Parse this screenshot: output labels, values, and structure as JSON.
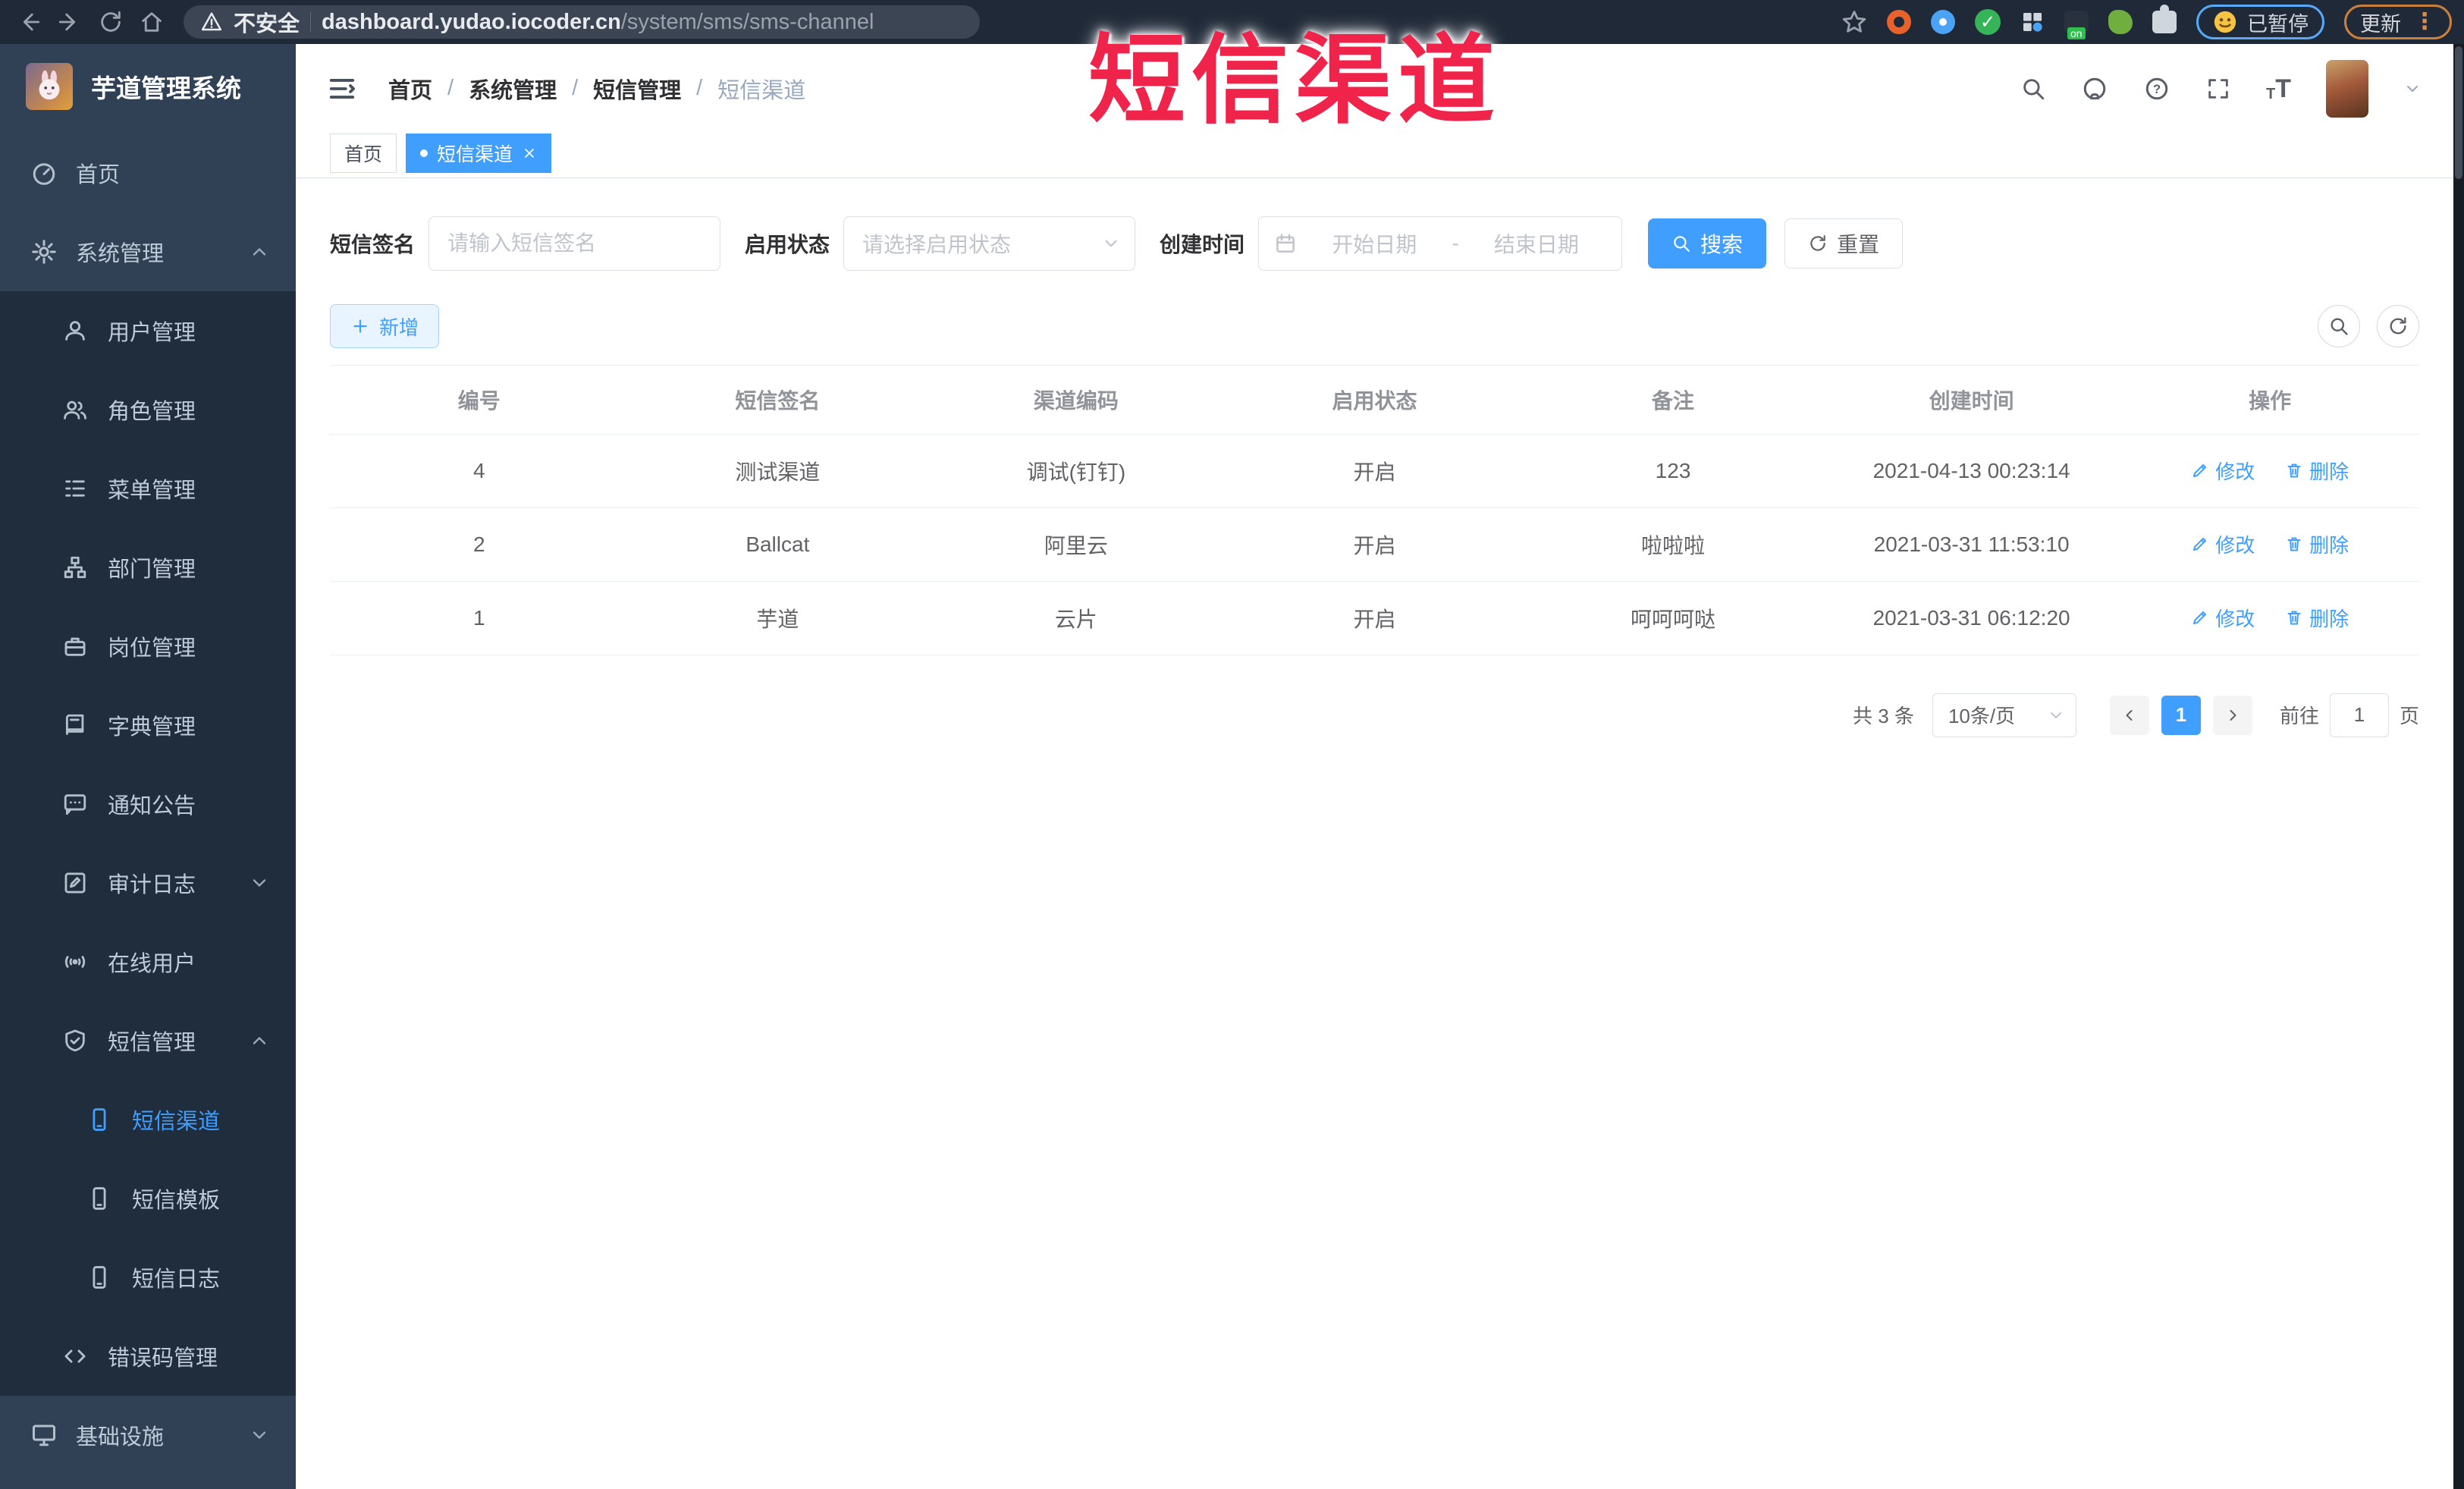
{
  "browser": {
    "security_label": "不安全",
    "url_domain": "dashboard.yudao.iocoder.cn",
    "url_path": "/system/sms/sms-channel",
    "paused_label": "已暂停",
    "update_label": "更新"
  },
  "overlay_title": "短信渠道",
  "sidebar": {
    "title": "芋道管理系统",
    "items": [
      {
        "label": "首页"
      },
      {
        "label": "系统管理"
      },
      {
        "label": "用户管理"
      },
      {
        "label": "角色管理"
      },
      {
        "label": "菜单管理"
      },
      {
        "label": "部门管理"
      },
      {
        "label": "岗位管理"
      },
      {
        "label": "字典管理"
      },
      {
        "label": "通知公告"
      },
      {
        "label": "审计日志"
      },
      {
        "label": "在线用户"
      },
      {
        "label": "短信管理"
      },
      {
        "label": "短信渠道"
      },
      {
        "label": "短信模板"
      },
      {
        "label": "短信日志"
      },
      {
        "label": "错误码管理"
      },
      {
        "label": "基础设施"
      }
    ]
  },
  "header": {
    "separator": "/",
    "breadcrumb": [
      {
        "label": "首页"
      },
      {
        "label": "系统管理"
      },
      {
        "label": "短信管理"
      },
      {
        "label": "短信渠道"
      }
    ]
  },
  "tabs": [
    {
      "label": "首页"
    },
    {
      "label": "短信渠道"
    }
  ],
  "search": {
    "sign_label": "短信签名",
    "sign_placeholder": "请输入短信签名",
    "status_label": "启用状态",
    "status_placeholder": "请选择启用状态",
    "time_label": "创建时间",
    "start_placeholder": "开始日期",
    "range_separator": "-",
    "end_placeholder": "结束日期",
    "search_label": "搜索",
    "reset_label": "重置"
  },
  "toolbar": {
    "add_label": "新增"
  },
  "table": {
    "headers": [
      "编号",
      "短信签名",
      "渠道编码",
      "启用状态",
      "备注",
      "创建时间",
      "操作"
    ],
    "edit_label": "修改",
    "delete_label": "删除",
    "rows": [
      {
        "id": "4",
        "sign": "测试渠道",
        "code": "调试(钉钉)",
        "status": "开启",
        "remark": "123",
        "created": "2021-04-13 00:23:14"
      },
      {
        "id": "2",
        "sign": "Ballcat",
        "code": "阿里云",
        "status": "开启",
        "remark": "啦啦啦",
        "created": "2021-03-31 11:53:10"
      },
      {
        "id": "1",
        "sign": "芋道",
        "code": "云片",
        "status": "开启",
        "remark": "呵呵呵哒",
        "created": "2021-03-31 06:12:20"
      }
    ]
  },
  "pagination": {
    "total": "共 3 条",
    "page_size": "10条/页",
    "page": "1",
    "goto_label": "前往",
    "goto_value": "1",
    "unit_label": "页"
  },
  "colors": {
    "accent": "#409eff",
    "sidebar_bg": "#304156",
    "submenu_bg": "#1f2d3d",
    "overlay_red": "#f0244a"
  }
}
